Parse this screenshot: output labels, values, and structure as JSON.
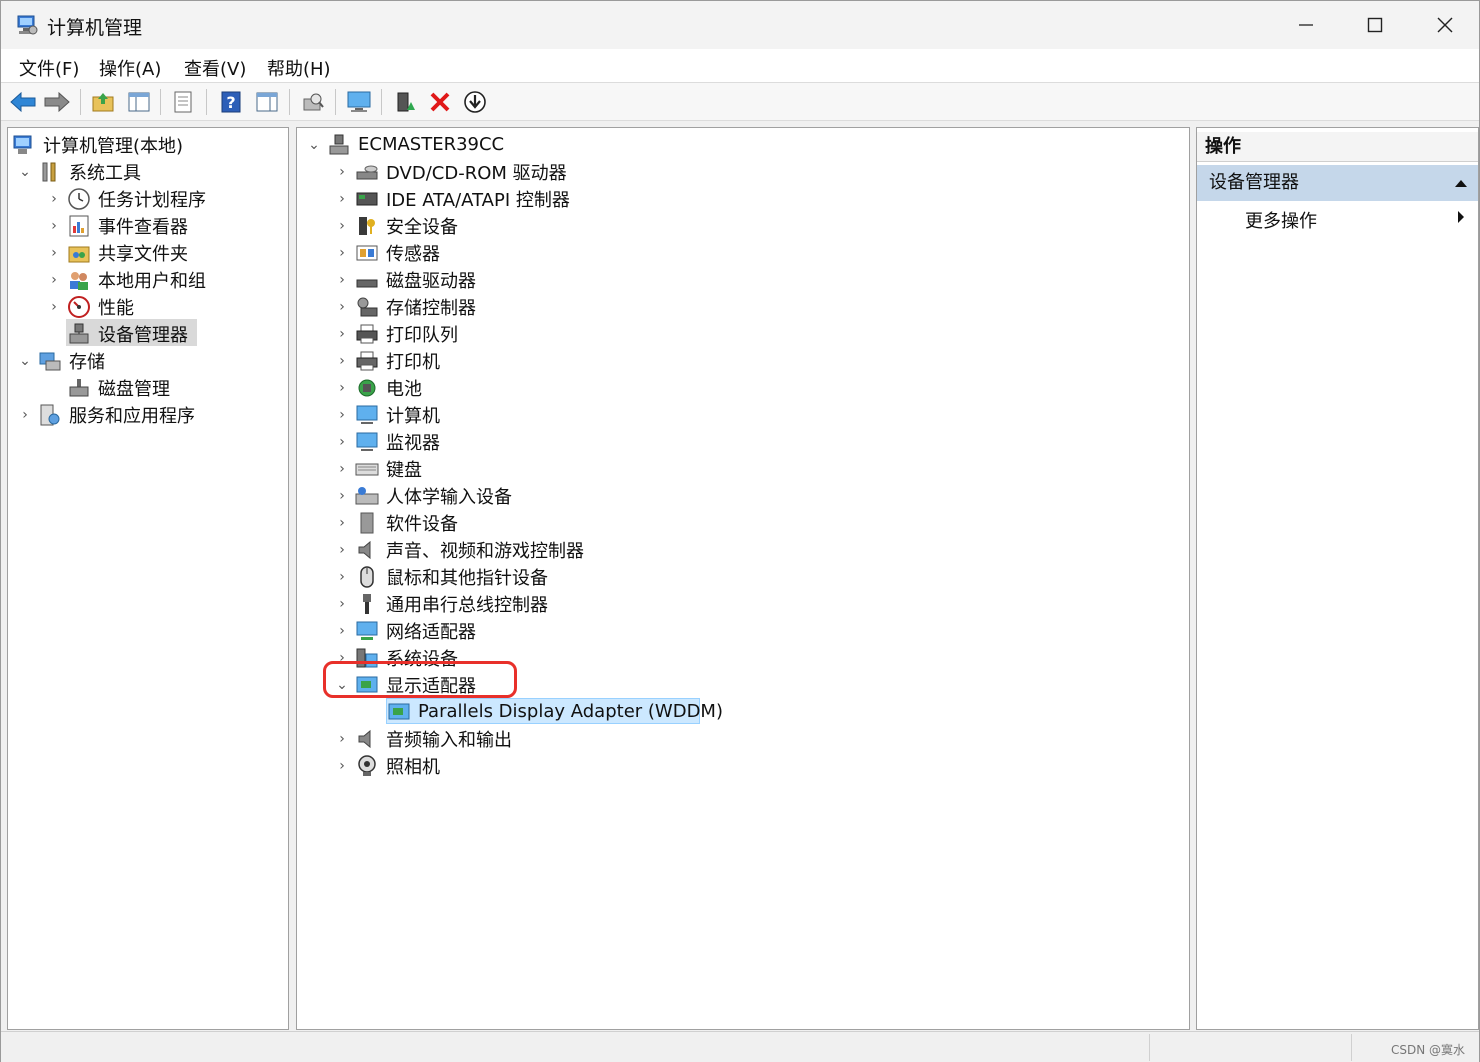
{
  "window": {
    "title": "计算机管理",
    "app_icon": "computer-management-icon"
  },
  "menu": {
    "items": [
      "文件(F)",
      "操作(A)",
      "查看(V)",
      "帮助(H)"
    ]
  },
  "toolbar": {
    "icons": [
      "back-icon",
      "forward-icon",
      "up-folder-icon",
      "show-hide-console-tree-icon",
      "export-list-icon",
      "help-icon",
      "show-hide-action-pane-icon",
      "scan-hardware-icon",
      "computer-icon",
      "update-driver-icon",
      "uninstall-device-icon",
      "disable-device-icon"
    ]
  },
  "left_tree": {
    "root": "计算机管理(本地)",
    "system_tools": "系统工具",
    "task_scheduler": "任务计划程序",
    "event_viewer": "事件查看器",
    "shared_folders": "共享文件夹",
    "local_users": "本地用户和组",
    "performance": "性能",
    "device_manager": "设备管理器",
    "storage": "存储",
    "disk_management": "磁盘管理",
    "services_apps": "服务和应用程序"
  },
  "device_tree": {
    "root": "ECMASTER39CC",
    "categories": [
      "DVD/CD-ROM 驱动器",
      "IDE ATA/ATAPI 控制器",
      "安全设备",
      "传感器",
      "磁盘驱动器",
      "存储控制器",
      "打印队列",
      "打印机",
      "电池",
      "计算机",
      "监视器",
      "键盘",
      "人体学输入设备",
      "软件设备",
      "声音、视频和游戏控制器",
      "鼠标和其他指针设备",
      "通用串行总线控制器",
      "网络适配器",
      "系统设备",
      "显示适配器",
      "音频输入和输出",
      "照相机"
    ],
    "expanded_child": "Parallels Display Adapter (WDDM)"
  },
  "actions": {
    "header": "操作",
    "section": "设备管理器",
    "more": "更多操作"
  },
  "status": {
    "watermark": "CSDN @寞水"
  },
  "colors": {
    "selection": "#cce8ff",
    "highlight_box": "#e8302a",
    "actions_section": "#c5d7ea"
  }
}
